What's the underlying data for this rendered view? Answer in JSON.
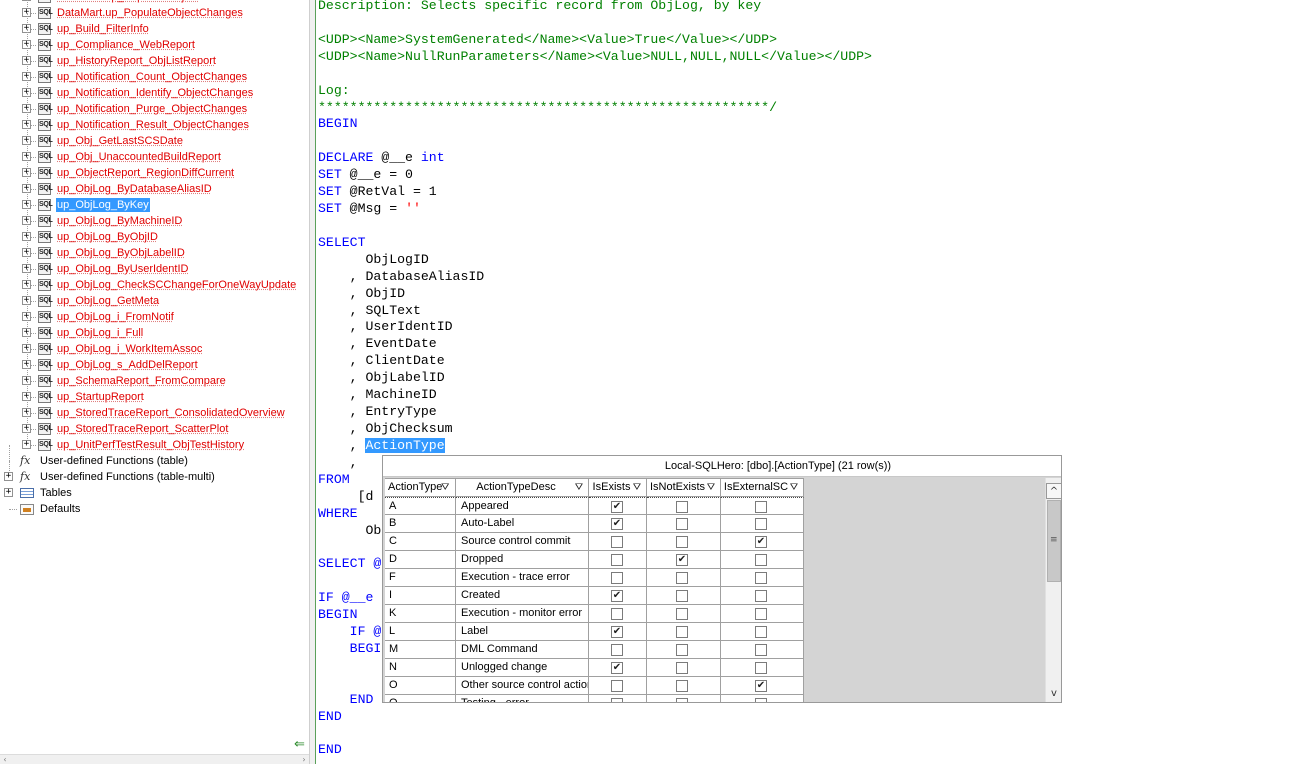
{
  "tree": {
    "top_partial_item": "DataMart.up_PopulateObject",
    "procedures": [
      "DataMart.up_PopulateObjectChanges",
      "up_Build_FilterInfo",
      "up_Compliance_WebReport",
      "up_HistoryReport_ObjListReport",
      "up_Notification_Count_ObjectChanges",
      "up_Notification_Identify_ObjectChanges",
      "up_Notification_Purge_ObjectChanges",
      "up_Notification_Result_ObjectChanges",
      "up_Obj_GetLastSCSDate",
      "up_Obj_UnaccountedBuildReport",
      "up_ObjectReport_RegionDiffCurrent",
      "up_ObjLog_ByDatabaseAliasID",
      "up_ObjLog_ByKey",
      "up_ObjLog_ByMachineID",
      "up_ObjLog_ByObjID",
      "up_ObjLog_ByObjLabelID",
      "up_ObjLog_ByUserIdentID",
      "up_ObjLog_CheckSCChangeForOneWayUpdate",
      "up_ObjLog_GetMeta",
      "up_ObjLog_i_FromNotif",
      "up_ObjLog_i_Full",
      "up_ObjLog_i_WorkItemAssoc",
      "up_ObjLog_s_AddDelReport",
      "up_SchemaReport_FromCompare",
      "up_StartupReport",
      "up_StoredTraceReport_ConsolidatedOverview",
      "up_StoredTraceReport_ScatterPlot",
      "up_UnitPerfTestResult_ObjTestHistory"
    ],
    "selected_procedure": "up_ObjLog_ByKey",
    "sql_icon_text": "SQL",
    "expander_symbol": "+",
    "categories": [
      {
        "label": "User-defined Functions (table)",
        "icon": "function-icon",
        "glyph": "fx"
      },
      {
        "label": "User-defined Functions (table-multi)",
        "icon": "function-icon",
        "glyph": "fx"
      },
      {
        "label": "Tables",
        "icon": "table-icon",
        "glyph": ""
      },
      {
        "label": "Defaults",
        "icon": "defaults-icon",
        "glyph": ""
      }
    ],
    "back_arrow_glyph": "⇐",
    "scroll_left_glyph": "‹",
    "scroll_right_glyph": "›"
  },
  "editor": {
    "lines": [
      [
        {
          "t": "Description: Selects specific record from ObjLog, by key",
          "c": "cm"
        }
      ],
      [],
      [
        {
          "t": "<UDP><Name>SystemGenerated</Name><Value>True</Value></UDP>",
          "c": "cm"
        }
      ],
      [
        {
          "t": "<UDP><Name>NullRunParameters</Name><Value>NULL,NULL,NULL</Value></UDP>",
          "c": "cm"
        }
      ],
      [],
      [
        {
          "t": "Log:",
          "c": "cm"
        }
      ],
      [
        {
          "t": "*********************************************************/",
          "c": "cm"
        }
      ],
      [
        {
          "t": "BEGIN",
          "c": "kw"
        }
      ],
      [],
      [
        {
          "t": "DECLARE ",
          "c": "kw"
        },
        {
          "t": "@__e ",
          "c": "var"
        },
        {
          "t": "int",
          "c": "ty"
        }
      ],
      [
        {
          "t": "SET ",
          "c": "kw"
        },
        {
          "t": "@__e = 0",
          "c": "var"
        }
      ],
      [
        {
          "t": "SET ",
          "c": "kw"
        },
        {
          "t": "@RetVal = 1",
          "c": "var"
        }
      ],
      [
        {
          "t": "SET ",
          "c": "kw"
        },
        {
          "t": "@Msg = ",
          "c": "var"
        },
        {
          "t": "''",
          "c": "str"
        }
      ],
      [],
      [
        {
          "t": "SELECT",
          "c": "kw"
        }
      ],
      [
        {
          "t": "      ObjLogID",
          "c": "id"
        }
      ],
      [
        {
          "t": "    , DatabaseAliasID",
          "c": "id"
        }
      ],
      [
        {
          "t": "    , ObjID",
          "c": "id"
        }
      ],
      [
        {
          "t": "    , SQLText",
          "c": "id"
        }
      ],
      [
        {
          "t": "    , UserIdentID",
          "c": "id"
        }
      ],
      [
        {
          "t": "    , EventDate",
          "c": "id"
        }
      ],
      [
        {
          "t": "    , ClientDate",
          "c": "id"
        }
      ],
      [
        {
          "t": "    , ObjLabelID",
          "c": "id"
        }
      ],
      [
        {
          "t": "    , MachineID",
          "c": "id"
        }
      ],
      [
        {
          "t": "    , EntryType",
          "c": "id"
        }
      ],
      [
        {
          "t": "    , ObjChecksum",
          "c": "id"
        }
      ],
      [
        {
          "t": "    , ",
          "c": "id"
        },
        {
          "t": "ActionType",
          "c": "hl"
        }
      ],
      [
        {
          "t": "    ,",
          "c": "id"
        }
      ],
      [
        {
          "t": "FROM",
          "c": "kw"
        }
      ],
      [
        {
          "t": "     [d",
          "c": "id"
        }
      ],
      [
        {
          "t": "WHERE",
          "c": "kw"
        }
      ],
      [
        {
          "t": "      Ob",
          "c": "id"
        }
      ],
      [],
      [
        {
          "t": "SELECT @",
          "c": "kw"
        }
      ],
      [],
      [
        {
          "t": "IF @__e",
          "c": "kw"
        }
      ],
      [
        {
          "t": "BEGIN",
          "c": "kw"
        }
      ],
      [
        {
          "t": "    IF @",
          "c": "kw"
        }
      ],
      [
        {
          "t": "    BEGI",
          "c": "kw"
        }
      ],
      [],
      [],
      [
        {
          "t": "    END",
          "c": "kw"
        }
      ],
      [
        {
          "t": "END",
          "c": "kw"
        }
      ],
      [],
      [
        {
          "t": "END",
          "c": "kw"
        }
      ]
    ]
  },
  "popup": {
    "title": "Local-SQLHero:  [dbo].[ActionType] (21 row(s))",
    "columns": [
      "ActionType",
      "ActionTypeDesc",
      "IsExists",
      "IsNotExists",
      "IsExternalSC"
    ],
    "filter_glyph": "⛛",
    "check_glyph": "✔",
    "rows": [
      {
        "code": "A",
        "desc": "Appeared",
        "is_exists": true,
        "is_not_exists": false,
        "is_external_sc": false
      },
      {
        "code": "B",
        "desc": "Auto-Label",
        "is_exists": true,
        "is_not_exists": false,
        "is_external_sc": false
      },
      {
        "code": "C",
        "desc": "Source control commit",
        "is_exists": false,
        "is_not_exists": false,
        "is_external_sc": true
      },
      {
        "code": "D",
        "desc": "Dropped",
        "is_exists": false,
        "is_not_exists": true,
        "is_external_sc": false
      },
      {
        "code": "F",
        "desc": "Execution - trace error",
        "is_exists": false,
        "is_not_exists": false,
        "is_external_sc": false
      },
      {
        "code": "I",
        "desc": "Created",
        "is_exists": true,
        "is_not_exists": false,
        "is_external_sc": false
      },
      {
        "code": "K",
        "desc": "Execution - monitor error",
        "is_exists": false,
        "is_not_exists": false,
        "is_external_sc": false
      },
      {
        "code": "L",
        "desc": "Label",
        "is_exists": true,
        "is_not_exists": false,
        "is_external_sc": false
      },
      {
        "code": "M",
        "desc": "DML Command",
        "is_exists": false,
        "is_not_exists": false,
        "is_external_sc": false
      },
      {
        "code": "N",
        "desc": "Unlogged change",
        "is_exists": true,
        "is_not_exists": false,
        "is_external_sc": false
      },
      {
        "code": "O",
        "desc": "Other source control action",
        "is_exists": false,
        "is_not_exists": false,
        "is_external_sc": true
      },
      {
        "code": "Q",
        "desc": "Testing - error",
        "is_exists": false,
        "is_not_exists": false,
        "is_external_sc": false
      }
    ],
    "scroll_up_glyph": "^",
    "scroll_grip_glyph": "≡",
    "scroll_down_glyph": "v"
  },
  "colors": {
    "selection": "#3399ff",
    "procedure_text": "#e00000",
    "comment": "#008000",
    "keyword": "#0000ff",
    "string": "#ff0000",
    "splitter_accent": "#5aa05a"
  }
}
